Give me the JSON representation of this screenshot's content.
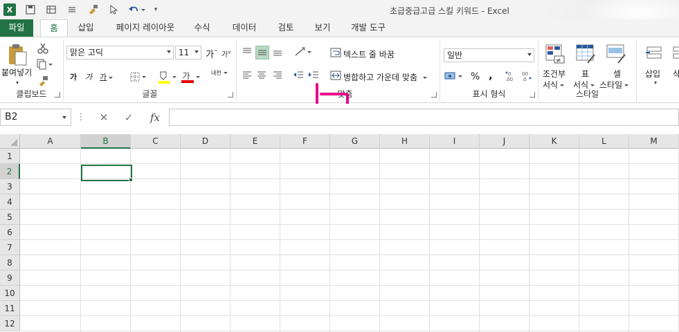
{
  "title": "초급중급고급 스킬 키워드 - Excel",
  "qat": [
    "excel-logo",
    "save-icon",
    "form-icon",
    "touch-mode-icon",
    "format-painter-icon",
    "pointer-icon",
    "undo-icon",
    "customize-icon"
  ],
  "tabs": [
    "파일",
    "홈",
    "삽입",
    "페이지 레이아웃",
    "수식",
    "데이터",
    "검토",
    "보기",
    "개발 도구"
  ],
  "ribbon": {
    "clipboard": {
      "paste": "붙여넣기",
      "label": "클립보드"
    },
    "font": {
      "name": "맑은 고딕",
      "size": "11",
      "bold": "가",
      "italic": "가",
      "underline": "가",
      "color_a": "가",
      "phonetic": "내천",
      "label": "글꼴",
      "grow": "가",
      "shrink": "가"
    },
    "alignment": {
      "wrap": "텍스트 줄 바꿈",
      "merge": "병합하고 가운데 맞춤",
      "label": "맞춤"
    },
    "number": {
      "format": "일반",
      "label": "표시 형식",
      "percent": "%",
      "comma": ","
    },
    "styles": {
      "conditional": "조건부",
      "conditional2": "서식",
      "table": "표",
      "table2": "서식",
      "cell": "셀",
      "cell2": "스타일",
      "label": "스타일"
    },
    "cells": {
      "insert": "삽입",
      "delete": "삭"
    }
  },
  "formula_bar": {
    "name_box": "B2",
    "fx": "fx",
    "value": ""
  },
  "columns": [
    "A",
    "B",
    "C",
    "D",
    "E",
    "F",
    "G",
    "H",
    "I",
    "J",
    "K",
    "L",
    "M"
  ],
  "rows": [
    "1",
    "2",
    "3",
    "4",
    "5",
    "6",
    "7",
    "8",
    "9",
    "10",
    "11",
    "12"
  ],
  "selected": {
    "column": "B",
    "row": "2"
  },
  "colors": {
    "accent": "#217346",
    "annotation": "#e6008a"
  }
}
